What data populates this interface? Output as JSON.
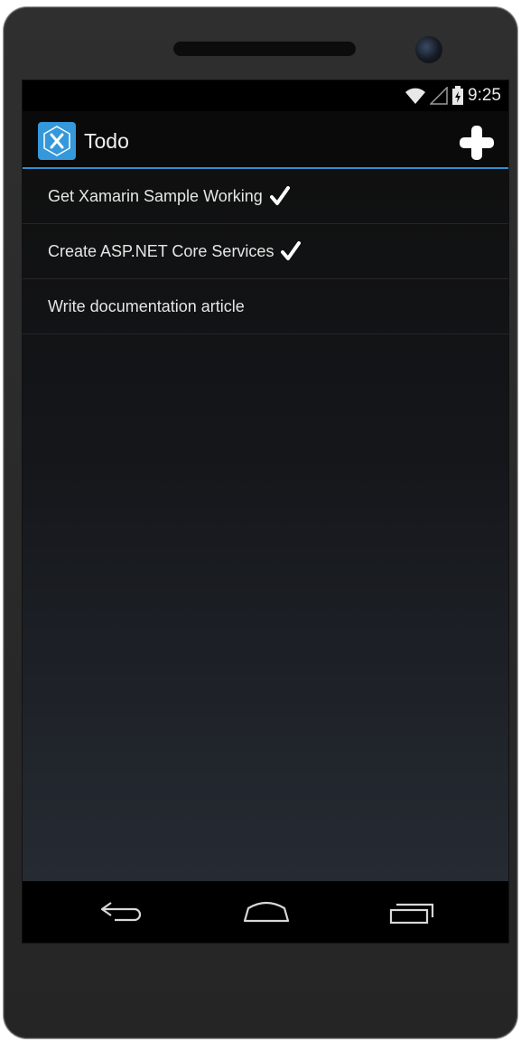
{
  "status_bar": {
    "time": "9:25",
    "icons": [
      "wifi-icon",
      "signal-icon",
      "battery-icon"
    ]
  },
  "action_bar": {
    "title": "Todo",
    "logo_icon": "xamarin-logo-icon",
    "add_icon": "plus-icon",
    "accent_color": "#2f8fcf",
    "logo_color": "#3498db"
  },
  "todo_items": [
    {
      "label": "Get Xamarin Sample Working",
      "done": true
    },
    {
      "label": "Create ASP.NET Core Services",
      "done": true
    },
    {
      "label": "Write documentation article",
      "done": false
    }
  ],
  "nav_bar": {
    "buttons": [
      "back-icon",
      "home-icon",
      "recent-apps-icon"
    ]
  }
}
